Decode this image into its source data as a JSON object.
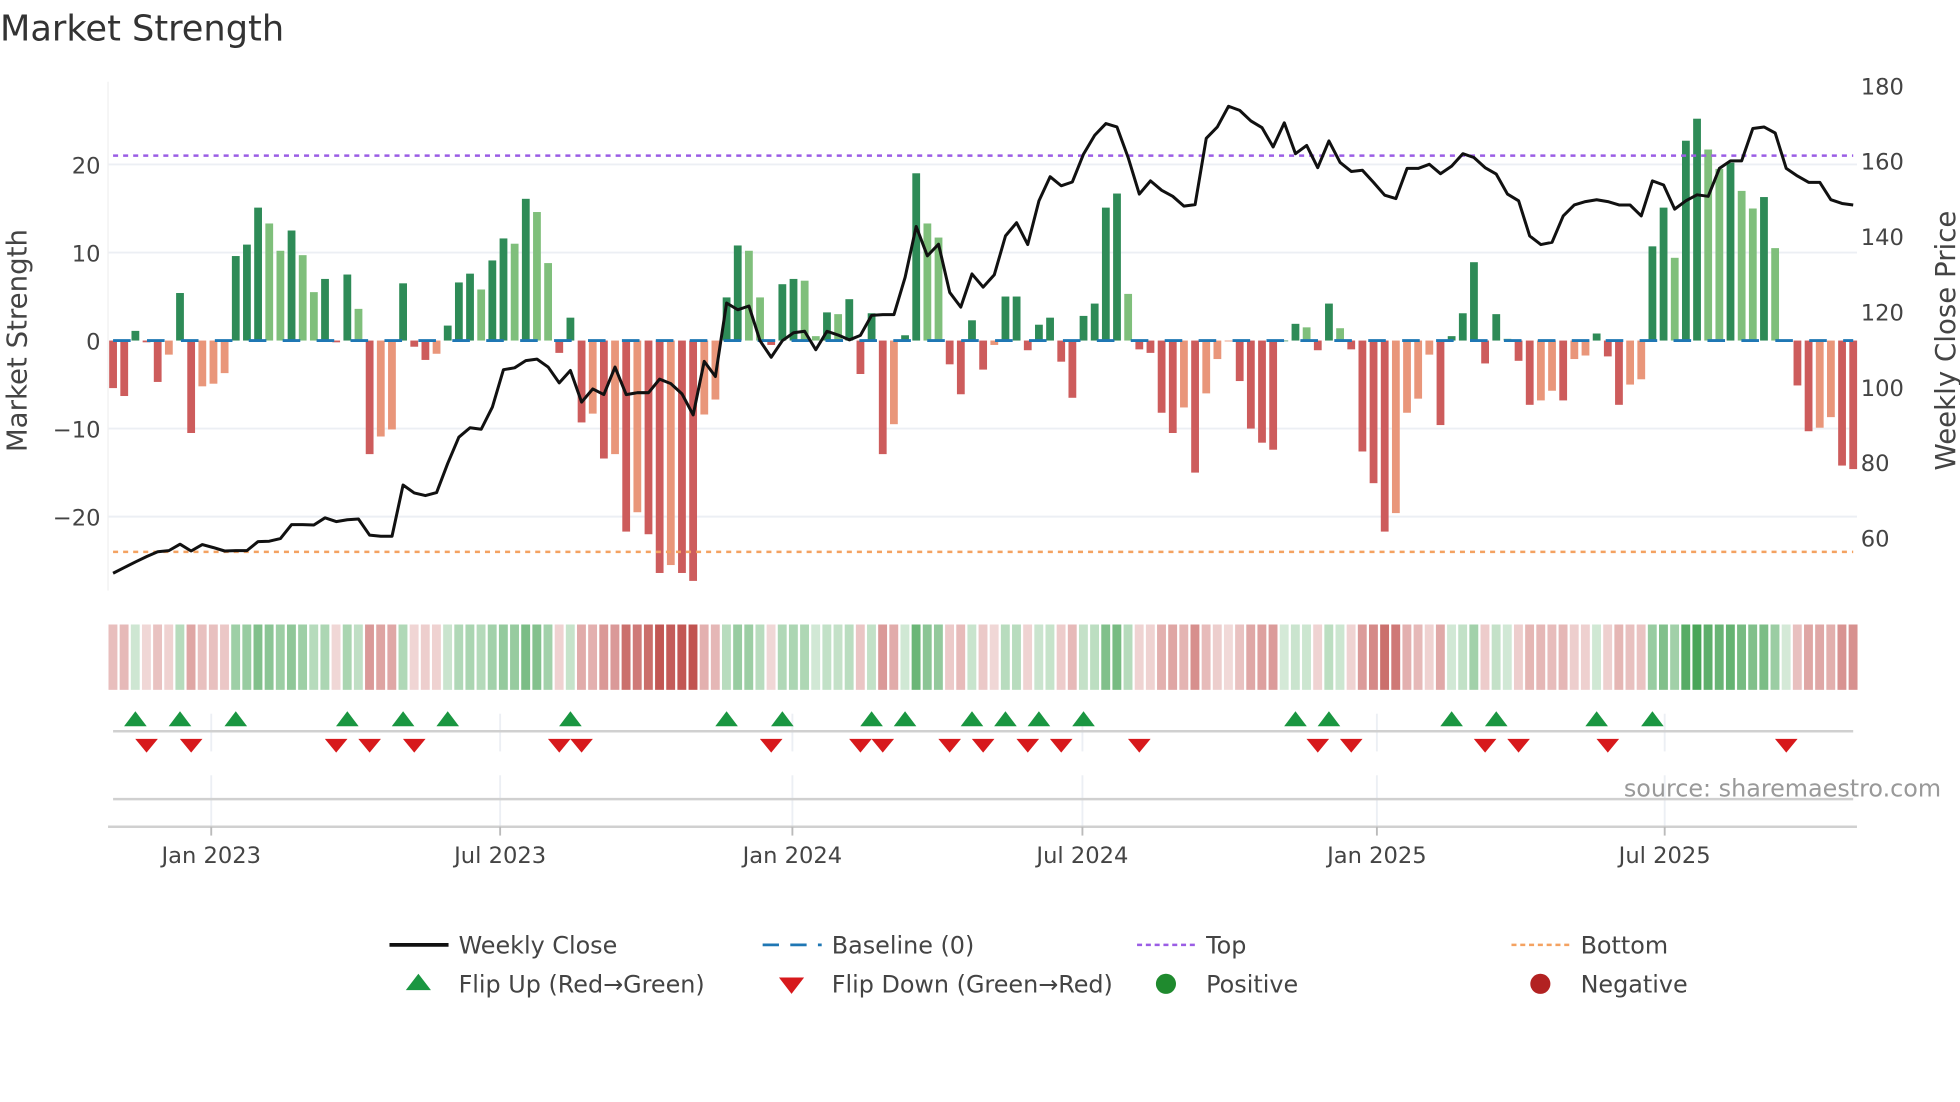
{
  "title": "Market Strength",
  "source": "source: sharemaestro.com",
  "colors": {
    "pos_strong": "#2e8b57",
    "pos_weak": "#7fbf7b",
    "neg_strong": "#cd5c5c",
    "neg_weak": "#e9967a",
    "strip_pos": "#3a9d4a",
    "strip_neg": "#c0504d",
    "baseline": "#1f77b4",
    "top": "#9b5de5",
    "bottom": "#f4a261",
    "close": "#111111",
    "flip_up": "#1a9641",
    "flip_down": "#d7191c"
  },
  "chart_data": {
    "type": "bar",
    "title": "Market Strength",
    "ylabel": "Market Strength",
    "y2label": "Weekly Close Price",
    "ylim": [
      -28.4,
      29.4
    ],
    "y2lim": [
      46,
      181
    ],
    "yticks": [
      {
        "v": -20,
        "label": "−20"
      },
      {
        "v": -10,
        "label": "−10"
      },
      {
        "v": 0,
        "label": "0"
      },
      {
        "v": 10,
        "label": "10"
      },
      {
        "v": 20,
        "label": "20"
      }
    ],
    "y2ticks": [
      {
        "v": 60,
        "label": "60"
      },
      {
        "v": 80,
        "label": "80"
      },
      {
        "v": 100,
        "label": "100"
      },
      {
        "v": 120,
        "label": "120"
      },
      {
        "v": 140,
        "label": "140"
      },
      {
        "v": 160,
        "label": "160"
      },
      {
        "v": 180,
        "label": "180"
      }
    ],
    "xticks": [
      {
        "week": 8.8,
        "label": "Jan 2023"
      },
      {
        "week": 34.7,
        "label": "Jul 2023"
      },
      {
        "week": 60.9,
        "label": "Jan 2024"
      },
      {
        "week": 86.9,
        "label": "Jul 2024"
      },
      {
        "week": 113.3,
        "label": "Jan 2025"
      },
      {
        "week": 139.1,
        "label": "Jul 2025"
      }
    ],
    "top_level": 21,
    "bottom_level": -24,
    "baseline": 0,
    "strength": [
      -5.4,
      -6.3,
      1.1,
      -0.2,
      -4.7,
      -1.6,
      5.4,
      -10.5,
      -5.2,
      -4.9,
      -3.7,
      9.6,
      10.9,
      15.1,
      13.3,
      10.2,
      12.5,
      9.7,
      5.5,
      7.0,
      -0.2,
      7.5,
      3.6,
      -12.9,
      -10.9,
      -10.1,
      6.5,
      -0.7,
      -2.2,
      -1.5,
      1.7,
      6.6,
      7.6,
      5.8,
      9.1,
      11.6,
      11.0,
      16.1,
      14.6,
      8.8,
      -1.4,
      2.6,
      -9.3,
      -8.3,
      -13.4,
      -12.9,
      -21.7,
      -19.5,
      -22.0,
      -26.4,
      -25.5,
      -26.4,
      -27.3,
      -8.4,
      -6.7,
      4.9,
      10.8,
      10.2,
      4.9,
      -0.5,
      6.4,
      7.0,
      6.8,
      0.5,
      3.2,
      3.0,
      4.7,
      -3.8,
      3.1,
      -12.9,
      -9.5,
      0.6,
      19.0,
      13.3,
      11.7,
      -2.7,
      -6.1,
      2.3,
      -3.3,
      -0.5,
      5.0,
      5.0,
      -1.1,
      1.8,
      2.6,
      -2.4,
      -6.5,
      2.8,
      4.2,
      15.1,
      16.7,
      5.3,
      -1.0,
      -1.4,
      -8.2,
      -10.5,
      -7.6,
      -15.0,
      -6.0,
      -2.1,
      -0.1,
      -4.6,
      -10.0,
      -11.6,
      -12.4,
      0.0,
      1.9,
      1.5,
      -1.1,
      4.2,
      1.4,
      -1.0,
      -12.6,
      -16.2,
      -21.7,
      -19.6,
      -8.2,
      -6.6,
      -1.6,
      -9.6,
      0.5,
      3.1,
      8.9,
      -2.6,
      3.0,
      0.2,
      -2.3,
      -7.3,
      -6.8,
      -5.7,
      -6.8,
      -2.1,
      -1.7,
      0.8,
      -1.8,
      -7.3,
      -5.0,
      -4.4,
      10.7,
      15.1,
      9.4,
      22.7,
      25.2,
      21.7,
      19.5,
      20.2,
      17.0,
      15.0,
      16.3,
      10.5,
      0.0,
      -5.1,
      -10.3,
      -9.9,
      -8.7,
      -14.2,
      -14.6
    ],
    "weekly_close": [
      50.6,
      52.1,
      53.6,
      55,
      56.3,
      56.6,
      58.3,
      56.5,
      58.2,
      57.4,
      56.5,
      56.6,
      56.6,
      59,
      59.1,
      59.8,
      63.5,
      63.5,
      63.4,
      65.3,
      64.3,
      64.8,
      65,
      60.7,
      60.4,
      60.4,
      74,
      71.9,
      71.2,
      72,
      79.7,
      86.7,
      89.2,
      88.8,
      94.7,
      104.6,
      105.1,
      107,
      107.4,
      105.3,
      101.1,
      104.4,
      96,
      99.5,
      98,
      105.3,
      98,
      98.5,
      98.5,
      102.1,
      100.9,
      98.2,
      92.6,
      106.8,
      102.8,
      122.3,
      120.5,
      121.5,
      112.3,
      107.9,
      112.3,
      114.4,
      114.8,
      109.9,
      114.8,
      113.8,
      112.5,
      113.7,
      119,
      119.2,
      119.2,
      129.1,
      142.6,
      134.8,
      137.9,
      125.1,
      121.2,
      130,
      126.5,
      129.8,
      140.1,
      143.6,
      137.8,
      149.4,
      155.8,
      153.4,
      154.4,
      161.8,
      166.8,
      169.9,
      169,
      160.9,
      151.2,
      154.7,
      152.2,
      150.6,
      148,
      148.4,
      166,
      169,
      174.5,
      173.4,
      170.6,
      168.8,
      163.7,
      170.1,
      161.9,
      164.1,
      158.2,
      165.3,
      159.6,
      157.2,
      157.5,
      154.3,
      150.9,
      150,
      158,
      158,
      159.1,
      156.6,
      158.6,
      161.9,
      160.9,
      158.2,
      156.5,
      151.2,
      149.4,
      140.1,
      137.8,
      138.4,
      145.4,
      148.3,
      149.2,
      149.7,
      149.2,
      148.3,
      148.3,
      145.4,
      154.7,
      153.6,
      147.2,
      149.4,
      151,
      150.6,
      158,
      160,
      160,
      168.6,
      169,
      167.4,
      158,
      156,
      154.3,
      154.3,
      149.7,
      148.7,
      148.3
    ],
    "flip_up_weeks": [
      2,
      6,
      11,
      21,
      26,
      30,
      41,
      55,
      60,
      68,
      71,
      77,
      80,
      83,
      87,
      106,
      109,
      120,
      124,
      133,
      138
    ],
    "flip_down_weeks": [
      3,
      7,
      20,
      23,
      27,
      40,
      42,
      59,
      67,
      69,
      75,
      78,
      82,
      85,
      92,
      108,
      111,
      123,
      126,
      134,
      150
    ],
    "legend": [
      {
        "key": "close",
        "label": "Weekly Close"
      },
      {
        "key": "baseline",
        "label": "Baseline (0)"
      },
      {
        "key": "top",
        "label": "Top"
      },
      {
        "key": "bottom",
        "label": "Bottom"
      },
      {
        "key": "flip_up",
        "label": "Flip Up (Red→Green)"
      },
      {
        "key": "flip_down",
        "label": "Flip Down (Green→Red)"
      },
      {
        "key": "positive",
        "label": "Positive"
      },
      {
        "key": "negative",
        "label": "Negative"
      }
    ],
    "legend_placement": "bottom"
  }
}
